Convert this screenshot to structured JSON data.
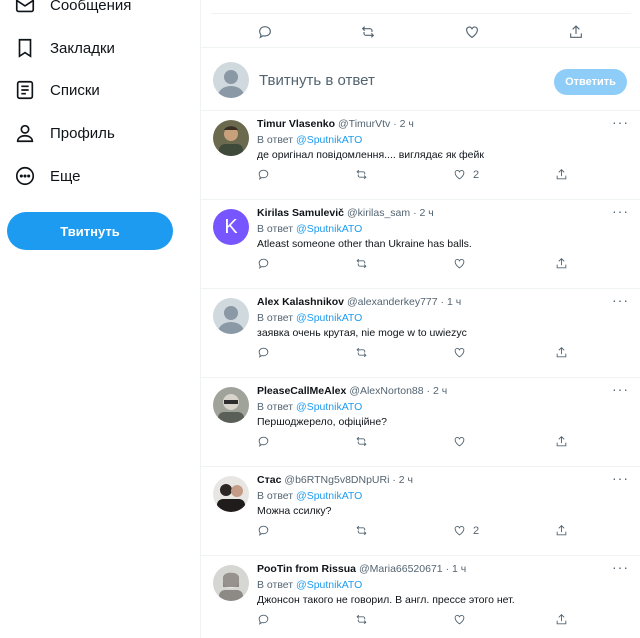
{
  "sidebar": {
    "items": [
      {
        "label": "Сообщения",
        "icon": "mail-icon"
      },
      {
        "label": "Закладки",
        "icon": "bookmark-icon"
      },
      {
        "label": "Списки",
        "icon": "list-icon"
      },
      {
        "label": "Профиль",
        "icon": "profile-icon"
      },
      {
        "label": "Еще",
        "icon": "more-circle-icon"
      }
    ],
    "tweet_button": "Твитнуть"
  },
  "compose": {
    "placeholder": "Твитнуть в ответ",
    "submit": "Ответить"
  },
  "replies": [
    {
      "name": "Timur Vlasenko",
      "handle": "@TimurVtv",
      "time": "2 ч",
      "reply_prefix": "В ответ",
      "mention": "@SputnikATO",
      "text": "де оригінал повідомлення.... виглядає як фейк",
      "likes": "2"
    },
    {
      "name": "Kirilas Samulevič",
      "handle": "@kirilas_sam",
      "time": "2 ч",
      "reply_prefix": "В ответ",
      "mention": "@SputnikATO",
      "text": "Atleast someone other than Ukraine has balls.",
      "likes": "",
      "avatar_letter": "K"
    },
    {
      "name": "Alex Kalashnikov",
      "handle": "@alexanderkey777",
      "time": "1 ч",
      "reply_prefix": "В ответ",
      "mention": "@SputnikATO",
      "text": "заявка очень крутая,  nie moge w to uwiezyc",
      "likes": ""
    },
    {
      "name": "PleaseCallMeAlex",
      "handle": "@AlexNorton88",
      "time": "2 ч",
      "reply_prefix": "В ответ",
      "mention": "@SputnikATO",
      "text": "Першоджерело, офіційне?",
      "likes": ""
    },
    {
      "name": "Стас",
      "handle": "@b6RTNg5v8DNpURi",
      "time": "2 ч",
      "reply_prefix": "В ответ",
      "mention": "@SputnikATO",
      "text": "Можна ссилку?",
      "likes": "2"
    },
    {
      "name": "PooTin from Rissua",
      "handle": "@Maria66520671",
      "time": "1 ч",
      "reply_prefix": "В ответ",
      "mention": "@SputnikATO",
      "text": "Джонсон такого не говорил. В англ. прессе этого нет.",
      "likes": ""
    }
  ],
  "separator": "·",
  "more_glyph": "···",
  "colors": {
    "accent": "#1d9bf0",
    "text": "#0f1419",
    "muted": "#536471",
    "avatar_k": "#7856ff"
  }
}
